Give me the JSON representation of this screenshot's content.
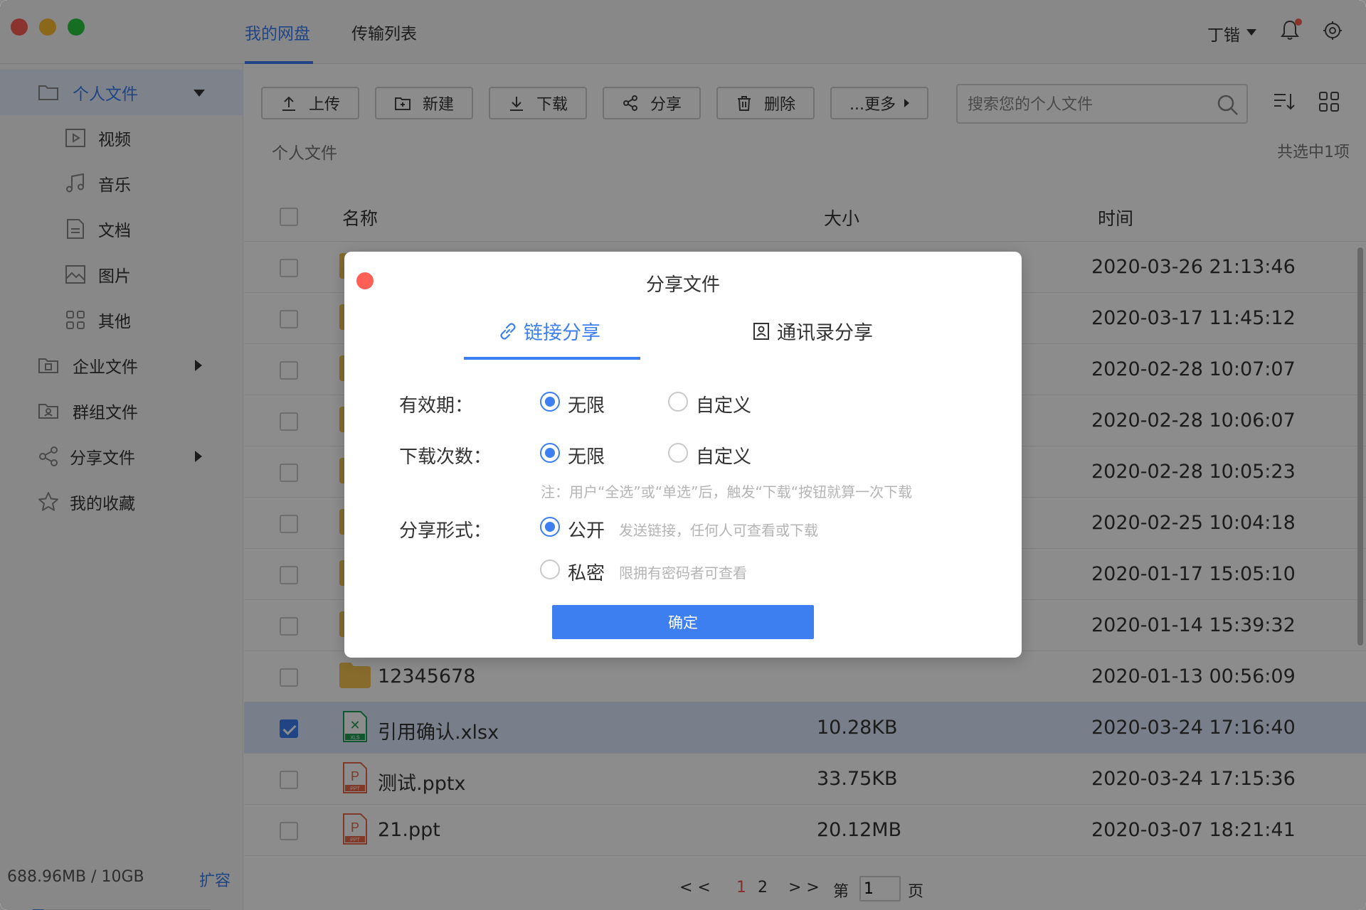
{
  "header": {
    "tabs": [
      {
        "label": "我的网盘",
        "active": true
      },
      {
        "label": "传输列表",
        "active": false
      }
    ],
    "user_name": "丁锴"
  },
  "sidebar": {
    "items": [
      {
        "label": "个人文件",
        "icon": "folder-icon",
        "active": true
      },
      {
        "label": "视频",
        "icon": "video-icon"
      },
      {
        "label": "音乐",
        "icon": "music-icon"
      },
      {
        "label": "文档",
        "icon": "document-icon"
      },
      {
        "label": "图片",
        "icon": "image-icon"
      },
      {
        "label": "其他",
        "icon": "apps-icon"
      },
      {
        "label": "企业文件",
        "icon": "enterprise-folder-icon"
      },
      {
        "label": "群组文件",
        "icon": "group-folder-icon"
      },
      {
        "label": "分享文件",
        "icon": "share-icon"
      },
      {
        "label": "我的收藏",
        "icon": "star-icon"
      }
    ],
    "storage_text": "688.96MB / 10GB",
    "storage_used_fraction": 0.067,
    "expand_label": "扩容"
  },
  "toolbar": {
    "buttons": [
      {
        "label": "上传",
        "icon": "upload-icon"
      },
      {
        "label": "新建",
        "icon": "new-folder-icon"
      },
      {
        "label": "下载",
        "icon": "download-icon"
      },
      {
        "label": "分享",
        "icon": "share-icon"
      },
      {
        "label": "删除",
        "icon": "trash-icon"
      },
      {
        "label": "...更多",
        "icon": "caret-right-icon"
      }
    ],
    "search_placeholder": "搜索您的个人文件"
  },
  "breadcrumb": "个人文件",
  "selection_count": "共选中1项",
  "table": {
    "columns": [
      "名称",
      "大小",
      "时间"
    ],
    "rows": [
      {
        "type": "folder",
        "name": "",
        "size": "",
        "time": "2020-03-26 21:13:46",
        "checked": false
      },
      {
        "type": "folder",
        "name": "",
        "size": "",
        "time": "2020-03-17 11:45:12",
        "checked": false
      },
      {
        "type": "folder",
        "name": "",
        "size": "",
        "time": "2020-02-28 10:07:07",
        "checked": false
      },
      {
        "type": "folder",
        "name": "",
        "size": "",
        "time": "2020-02-28 10:06:07",
        "checked": false
      },
      {
        "type": "folder",
        "name": "",
        "size": "",
        "time": "2020-02-28 10:05:23",
        "checked": false
      },
      {
        "type": "folder",
        "name": "",
        "size": "",
        "time": "2020-02-25 10:04:18",
        "checked": false
      },
      {
        "type": "folder",
        "name": "",
        "size": "",
        "time": "2020-01-17 15:05:10",
        "checked": false
      },
      {
        "type": "folder",
        "name": "",
        "size": "",
        "time": "2020-01-14 15:39:32",
        "checked": false
      },
      {
        "type": "folder",
        "name": "12345678",
        "size": "",
        "time": "2020-01-13 00:56:09",
        "checked": false
      },
      {
        "type": "xls",
        "badge": "XLS",
        "name": "引用确认.xlsx",
        "size": "10.28KB",
        "time": "2020-03-24 17:16:40",
        "checked": true
      },
      {
        "type": "ppt",
        "badge": "PPT",
        "name": "测试.pptx",
        "size": "33.75KB",
        "time": "2020-03-24 17:15:36",
        "checked": false
      },
      {
        "type": "ppt",
        "badge": "PPT",
        "name": "21.ppt",
        "size": "20.12MB",
        "time": "2020-03-07 18:21:41",
        "checked": false
      }
    ]
  },
  "pager": {
    "prev": "< <",
    "pages": [
      "1",
      "2"
    ],
    "current": "1",
    "next": "> >",
    "goto_prefix": "第",
    "goto_value": "1",
    "goto_suffix": "页"
  },
  "dialog": {
    "title": "分享文件",
    "tabs": [
      {
        "label": "链接分享",
        "icon": "link-icon",
        "active": true
      },
      {
        "label": "通讯录分享",
        "icon": "contacts-icon",
        "active": false
      }
    ],
    "validity": {
      "label": "有效期：",
      "options": [
        "无限",
        "自定义"
      ],
      "selected": "无限"
    },
    "download_count": {
      "label": "下载次数：",
      "options": [
        "无限",
        "自定义"
      ],
      "selected": "无限"
    },
    "note": "注：用户“全选”或“单选”后，触发“下载“按钮就算一次下载",
    "share_form": {
      "label": "分享形式：",
      "options": [
        {
          "label": "公开",
          "hint": "发送链接，任何人可查看或下载"
        },
        {
          "label": "私密",
          "hint": "限拥有密码者可查看"
        }
      ],
      "selected": "公开"
    },
    "confirm_label": "确定"
  },
  "colors": {
    "accent": "#3d7ff0",
    "folder": "#f5c451",
    "xls": "#1f9d55",
    "ppt": "#e8694a",
    "close_red": "#fe5f57"
  }
}
